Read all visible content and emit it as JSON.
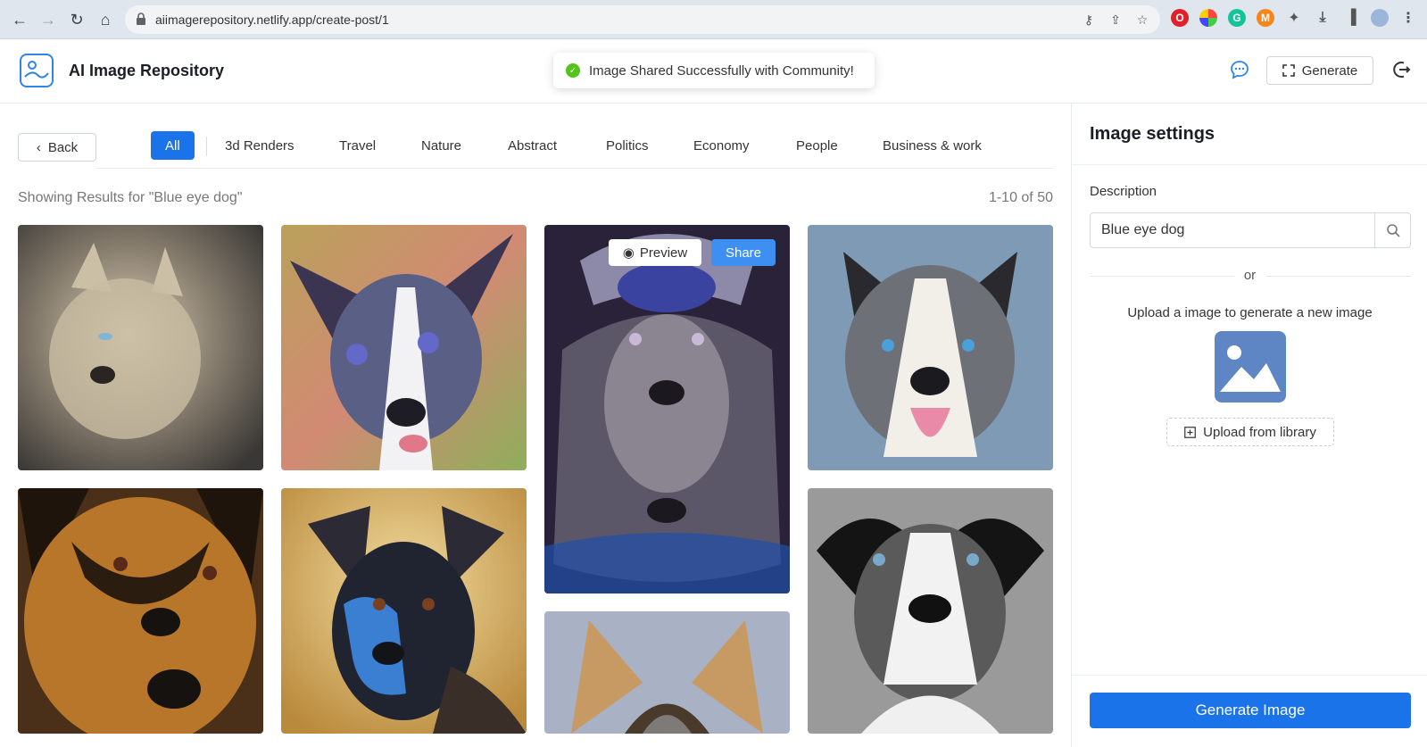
{
  "browser": {
    "url": "aiimagerepository.netlify.app/create-post/1"
  },
  "header": {
    "app_title": "AI Image Repository",
    "toast": "Image Shared Successfully with Community!",
    "generate_label": "Generate"
  },
  "main": {
    "back_label": "Back",
    "categories": [
      "All",
      "3d Renders",
      "Travel",
      "Nature",
      "Abstract",
      "Politics",
      "Economy",
      "People",
      "Business & work"
    ],
    "active_category": "All",
    "results_text": "Showing Results for \"Blue eye dog\"",
    "count_text": "1-10 of 50",
    "hover_preview_label": "Preview",
    "hover_share_label": "Share"
  },
  "panel": {
    "title": "Image settings",
    "description_label": "Description",
    "description_value": "Blue eye dog",
    "or_text": "or",
    "upload_text": "Upload a image to generate a new image",
    "upload_library_label": "Upload from library",
    "generate_image_label": "Generate Image"
  },
  "colors": {
    "primary": "#1a73e8",
    "share": "#3d8ff2",
    "success": "#52c41a"
  }
}
